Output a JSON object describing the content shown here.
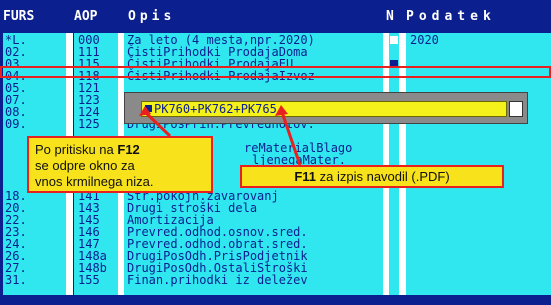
{
  "header": {
    "col_furs": "FURS",
    "col_aop": "AOP",
    "col_opis": "Opis",
    "col_n": "N",
    "col_podatek": "Podatek"
  },
  "rows": [
    {
      "furs": "*L.",
      "aop": "000",
      "opis": "Za leto (4 mesta,npr.2020)",
      "podatek": "2020"
    },
    {
      "furs": "02.",
      "aop": "111",
      "opis": "ČistiPrihodki ProdajaDoma",
      "podatek": ""
    },
    {
      "furs": "03.",
      "aop": "115",
      "opis": "ČistiPrihodki ProdajaEU",
      "podatek": ""
    },
    {
      "furs": "04.",
      "aop": "118",
      "opis": "ČistiPrihodki ProdajaIzvoz",
      "podatek": ""
    },
    {
      "furs": "05.",
      "aop": "121",
      "opis": "",
      "podatek": ""
    },
    {
      "furs": "07.",
      "aop": "123",
      "opis": "",
      "podatek": ""
    },
    {
      "furs": "08.",
      "aop": "124",
      "opis": "",
      "podatek": ""
    },
    {
      "furs": "09.",
      "aop": "125",
      "opis": "DrugiPosPrih.Prevrednotov.",
      "podatek": ""
    },
    {
      "furs": "",
      "aop": "",
      "opis": "",
      "podatek": ""
    },
    {
      "furs": "",
      "aop": "",
      "opis": "",
      "podatek": ""
    },
    {
      "furs": "",
      "aop": "",
      "opis": "",
      "podatek": ""
    },
    {
      "furs": "",
      "aop": "",
      "opis": "",
      "podatek": ""
    },
    {
      "furs": "",
      "aop": "",
      "opis": "",
      "podatek": ""
    },
    {
      "furs": "18.",
      "aop": "141",
      "opis": "Str.pokojn.zavarovanj",
      "podatek": ""
    },
    {
      "furs": "20.",
      "aop": "143",
      "opis": "Drugi stroški dela",
      "podatek": ""
    },
    {
      "furs": "22.",
      "aop": "145",
      "opis": "Amortizacija",
      "podatek": ""
    },
    {
      "furs": "23.",
      "aop": "146",
      "opis": "Prevred.odhod.osnov.sred.",
      "podatek": ""
    },
    {
      "furs": "24.",
      "aop": "147",
      "opis": "Prevred.odhod.obrat.sred.",
      "podatek": ""
    },
    {
      "furs": "26.",
      "aop": "148a",
      "opis": "DrugiPosOdh.PrisPodjetnik",
      "podatek": ""
    },
    {
      "furs": "27.",
      "aop": "148b",
      "opis": "DrugiPosOdh.OstaliStroški",
      "podatek": ""
    },
    {
      "furs": "31.",
      "aop": "155",
      "opis": "Finan.prihodki iz deležev",
      "podatek": ""
    }
  ],
  "hidden_fragments": {
    "row9_opis": "reMaterialBlago",
    "row10_opis": "ljenegaMater."
  },
  "popup": {
    "formula": "PK760+PK762+PK765"
  },
  "callouts": {
    "f12_text_1": "Po pritisku na ",
    "f12_key": "F12",
    "f12_text_2": "se odpre okno za",
    "f12_text_3": "vnos krmilnega niza.",
    "f11_key": "F11",
    "f11_text": " za izpis navodil (.PDF)"
  },
  "colors": {
    "frame": "#0c1f8e",
    "cells": "#30e7f0",
    "text": "#0c1f8e",
    "highlight": "#e82020",
    "callout": "#f8e21c",
    "input": "#f5f11a"
  }
}
